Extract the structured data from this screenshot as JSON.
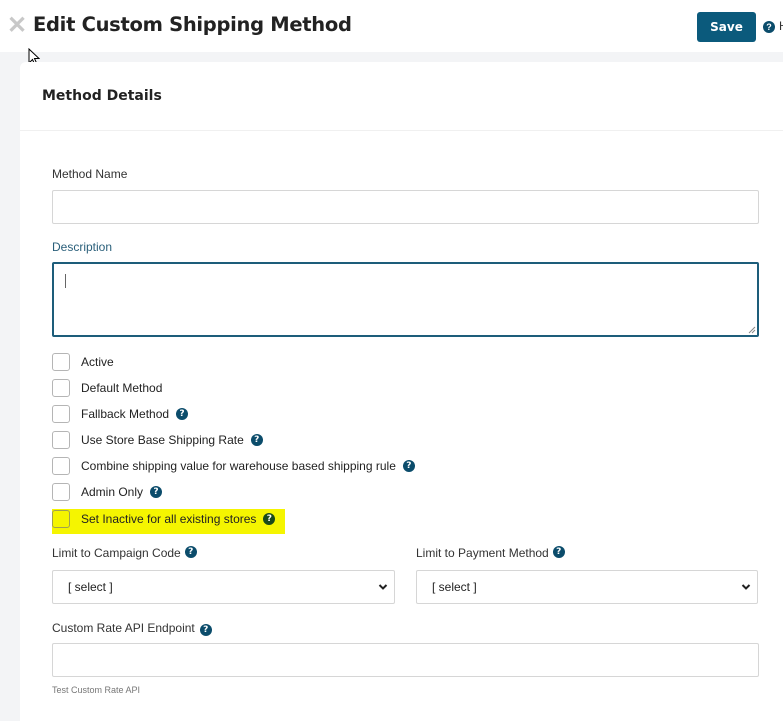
{
  "header": {
    "close_icon": "close-icon",
    "title": "Edit Custom Shipping Method",
    "save_label": "Save",
    "help_icon": "help-icon",
    "help_text": "H"
  },
  "section": {
    "title": "Method Details"
  },
  "fields": {
    "method_name": {
      "label": "Method Name",
      "value": "",
      "placeholder": ""
    },
    "description": {
      "label": "Description",
      "value": ""
    },
    "custom_rate": {
      "label": "Custom Rate API Endpoint",
      "value": "",
      "placeholder": "",
      "hint": "Test Custom Rate API"
    }
  },
  "checkboxes": [
    {
      "label": "Active",
      "checked": false,
      "help": false
    },
    {
      "label": "Default Method",
      "checked": false,
      "help": false
    },
    {
      "label": "Fallback Method",
      "checked": false,
      "help": true
    },
    {
      "label": "Use Store Base Shipping Rate",
      "checked": false,
      "help": true
    },
    {
      "label": "Combine shipping value for warehouse based shipping rule",
      "checked": false,
      "help": true
    },
    {
      "label": "Admin Only",
      "checked": false,
      "help": true
    },
    {
      "label": "Set Inactive for all existing stores",
      "checked": false,
      "help": true,
      "highlighted": true
    }
  ],
  "selects": {
    "campaign": {
      "label": "Limit to Campaign Code",
      "value": "[ select ]"
    },
    "payment": {
      "label": "Limit to Payment Method",
      "value": "[ select ]"
    }
  },
  "colors": {
    "primary": "#0b5a7c",
    "help_icon": "#0b4c6b",
    "highlight": "#f5f500",
    "focus_border": "#1d5d7a"
  }
}
